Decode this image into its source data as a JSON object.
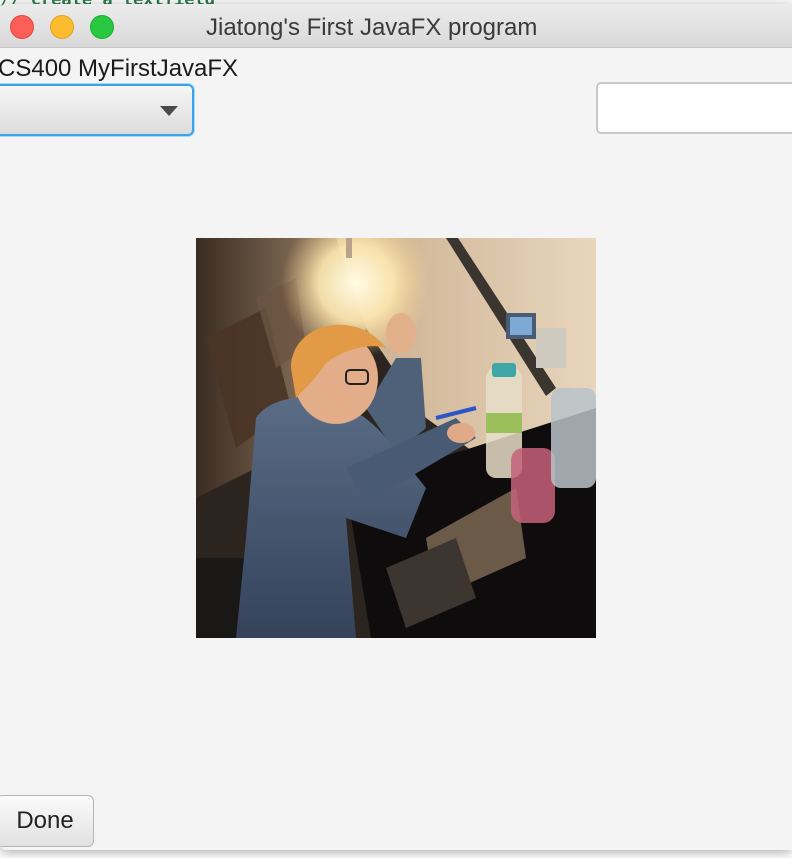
{
  "background": {
    "code_fragment": "// create a textfield"
  },
  "window": {
    "title": "Jiatong's First JavaFX program",
    "controls": [
      "close",
      "minimize",
      "maximize"
    ]
  },
  "content": {
    "label": "CS400 MyFirstJavaFX",
    "combo_box": {
      "selected_value": ""
    },
    "text_field": {
      "value": "",
      "placeholder": ""
    },
    "image": {
      "icon": "photo-image"
    },
    "done_button_label": "Done"
  },
  "colors": {
    "window_bg": "#f4f4f4",
    "focus_accent": "#3aa4e8",
    "close": "#fc5f57",
    "minimize": "#fdbc2e",
    "maximize": "#28c840"
  }
}
